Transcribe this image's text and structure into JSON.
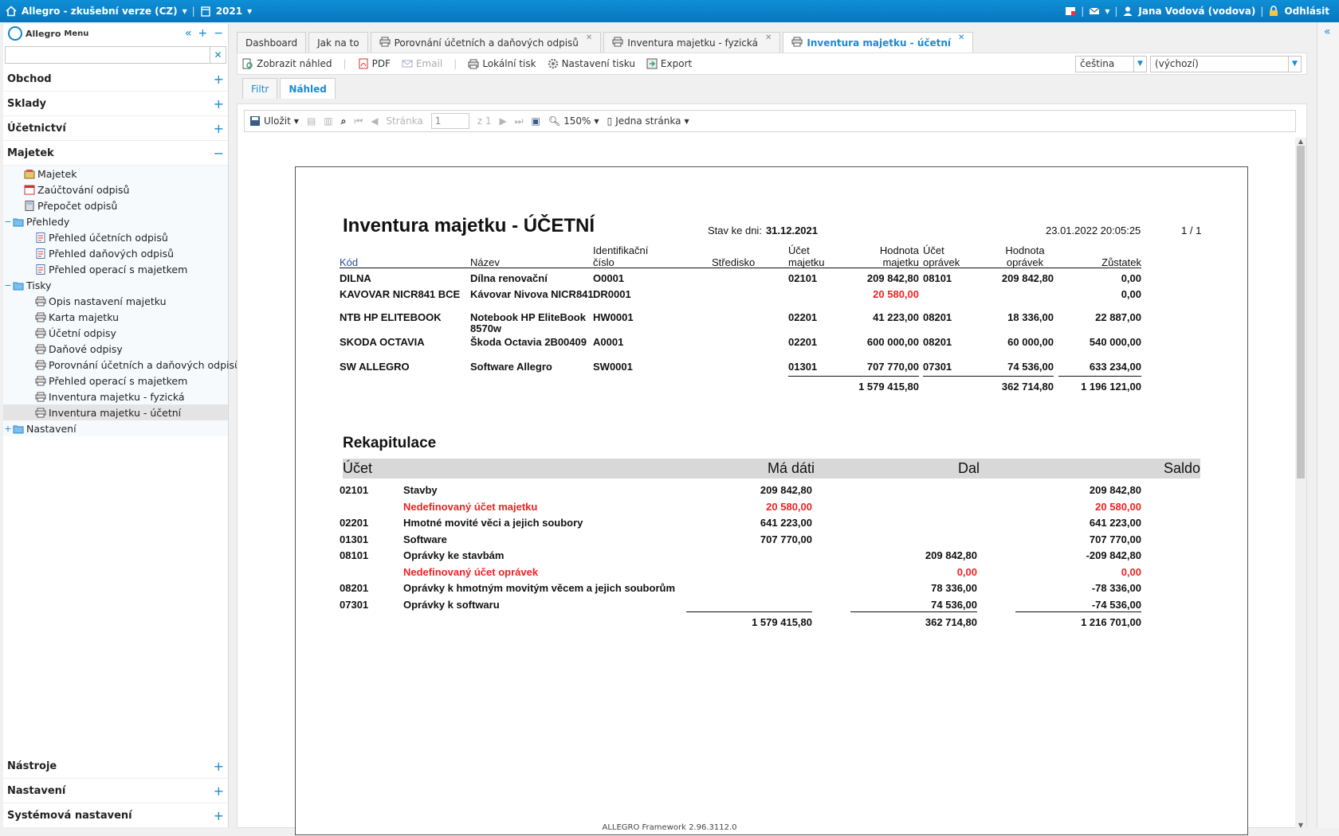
{
  "topbar": {
    "app_title": "Allegro - zkušební verze (CZ)",
    "year": "2021",
    "user": "Jana Vodová (vodova)",
    "logout": "Odhlásit"
  },
  "sidebar": {
    "app_name": "Allegro",
    "menu_label": "Menu",
    "search_placeholder": "",
    "sections_top": [
      {
        "label": "Obchod",
        "toggle": "+"
      },
      {
        "label": "Sklady",
        "toggle": "+"
      },
      {
        "label": "Účetnictví",
        "toggle": "+"
      },
      {
        "label": "Majetek",
        "toggle": "−"
      }
    ],
    "tree": [
      {
        "label": "Majetek",
        "indent": 1,
        "icon": "asset-icon"
      },
      {
        "label": "Zaúčtování odpisů",
        "indent": 1,
        "icon": "calendar-icon"
      },
      {
        "label": "Přepočet odpisů",
        "indent": 1,
        "icon": "calculator-icon"
      },
      {
        "label": "Přehledy",
        "indent": 0,
        "icon": "folder-icon",
        "exp": "−"
      },
      {
        "label": "Přehled účetních odpisů",
        "indent": 2,
        "icon": "report-icon"
      },
      {
        "label": "Přehled daňových odpisů",
        "indent": 2,
        "icon": "report-icon"
      },
      {
        "label": "Přehled operací s majetkem",
        "indent": 2,
        "icon": "report-icon"
      },
      {
        "label": "Tisky",
        "indent": 0,
        "icon": "folder-icon",
        "exp": "−"
      },
      {
        "label": "Opis nastavení majetku",
        "indent": 2,
        "icon": "printer-icon"
      },
      {
        "label": "Karta majetku",
        "indent": 2,
        "icon": "printer-icon"
      },
      {
        "label": "Účetní odpisy",
        "indent": 2,
        "icon": "printer-icon"
      },
      {
        "label": "Daňové odpisy",
        "indent": 2,
        "icon": "printer-icon"
      },
      {
        "label": "Porovnání účetních a daňových odpisů",
        "indent": 2,
        "icon": "printer-icon"
      },
      {
        "label": "Přehled operací s majetkem",
        "indent": 2,
        "icon": "printer-icon"
      },
      {
        "label": "Inventura majetku - fyzická",
        "indent": 2,
        "icon": "printer-icon"
      },
      {
        "label": "Inventura majetku - účetní",
        "indent": 2,
        "icon": "printer-icon",
        "selected": true
      },
      {
        "label": "Nastavení",
        "indent": 0,
        "icon": "folder-icon",
        "exp": "+"
      }
    ],
    "sections_bottom": [
      {
        "label": "Nástroje",
        "toggle": "+"
      },
      {
        "label": "Nastavení",
        "toggle": "+"
      },
      {
        "label": "Systémová nastavení",
        "toggle": "+"
      }
    ]
  },
  "tabs": [
    {
      "label": "Dashboard"
    },
    {
      "label": "Jak na to"
    },
    {
      "label": "Porovnání účetních a daňových odpisů",
      "closable": true,
      "icon": true
    },
    {
      "label": "Inventura majetku - fyzická",
      "closable": true,
      "icon": true
    },
    {
      "label": "Inventura majetku - účetní",
      "closable": true,
      "icon": true,
      "active": true
    }
  ],
  "toolbar": {
    "preview": "Zobrazit náhled",
    "pdf": "PDF",
    "email": "Email",
    "local_print": "Lokální tisk",
    "print_settings": "Nastavení tisku",
    "export": "Export",
    "language": "čeština",
    "variant": "(výchozí)"
  },
  "subtabs": {
    "filter": "Filtr",
    "preview": "Náhled"
  },
  "viewer": {
    "save": "Uložit",
    "page_label": "Stránka",
    "page_value": "1",
    "of_label": "z 1",
    "zoom": "150%",
    "layout": "Jedna stránka"
  },
  "report": {
    "title": "Inventura majetku - ÚČETNÍ",
    "stav_label": "Stav ke dni:",
    "stav_value": "31.12.2021",
    "datetime": "23.01.2022 20:05:25",
    "page": "1 / 1",
    "headers": {
      "kod": "Kód",
      "nazev": "Název",
      "ident1": "Identifikační",
      "ident2": "číslo",
      "stredisko": "Středisko",
      "ucet1": "Účet",
      "ucet2": "majetku",
      "hodnota1": "Hodnota",
      "hodnota2": "majetku",
      "ucetopr1": "Účet",
      "ucetopr2": "oprávek",
      "hodnotaopr1": "Hodnota",
      "hodnotaopr2": "oprávek",
      "zustatek": "Zůstatek"
    },
    "rows": [
      {
        "kod": "DILNA",
        "nazev": "Dílna renovační",
        "nazev2": "",
        "ident": "O0001",
        "ucet": "02101",
        "hodnota": "209 842,80",
        "hodnota_red": false,
        "ucetopr": "08101",
        "opravky": "209 842,80",
        "zustatek": "0,00"
      },
      {
        "kod": "KAVOVAR NICR841 BCE",
        "nazev": "Kávovar Nivova NICR841",
        "nazev2": "",
        "ident": "DR0001",
        "ucet": "",
        "hodnota": "20 580,00",
        "hodnota_red": true,
        "ucetopr": "",
        "opravky": "",
        "zustatek": "0,00"
      },
      {
        "kod": "NTB HP ELITEBOOK",
        "nazev": "Notebook HP EliteBook",
        "nazev2": "8570w",
        "ident": "HW0001",
        "ucet": "02201",
        "hodnota": "41 223,00",
        "hodnota_red": false,
        "ucetopr": "08201",
        "opravky": "18 336,00",
        "zustatek": "22 887,00"
      },
      {
        "kod": "SKODA OCTAVIA",
        "nazev": "Škoda Octavia 2B00409",
        "nazev2": "",
        "ident": "A0001",
        "ucet": "02201",
        "hodnota": "600 000,00",
        "hodnota_red": false,
        "ucetopr": "08201",
        "opravky": "60 000,00",
        "zustatek": "540 000,00"
      },
      {
        "kod": "SW ALLEGRO",
        "nazev": "Software Allegro",
        "nazev2": "",
        "ident": "SW0001",
        "ucet": "01301",
        "hodnota": "707 770,00",
        "hodnota_red": false,
        "ucetopr": "07301",
        "opravky": "74 536,00",
        "zustatek": "633 234,00"
      }
    ],
    "totals": {
      "hodnota": "1 579 415,80",
      "opravky": "362 714,80",
      "zustatek": "1 196 121,00"
    },
    "rekap": {
      "title": "Rekapitulace",
      "h_ucet": "Účet",
      "h_madati": "Má dáti",
      "h_dal": "Dal",
      "h_saldo": "Saldo",
      "rows": [
        {
          "ucet": "02101",
          "nazev": "Stavby",
          "madati": "209 842,80",
          "dal": "",
          "saldo": "209 842,80",
          "red": false
        },
        {
          "ucet": "",
          "nazev": "Nedefinovaný účet majetku",
          "madati": "20 580,00",
          "dal": "",
          "saldo": "20 580,00",
          "red": true
        },
        {
          "ucet": "02201",
          "nazev": "Hmotné movité věci a jejich soubory",
          "madati": "641 223,00",
          "dal": "",
          "saldo": "641 223,00",
          "red": false
        },
        {
          "ucet": "01301",
          "nazev": "Software",
          "madati": "707 770,00",
          "dal": "",
          "saldo": "707 770,00",
          "red": false
        },
        {
          "ucet": "08101",
          "nazev": "Oprávky ke stavbám",
          "madati": "",
          "dal": "209 842,80",
          "saldo": "-209 842,80",
          "red": false
        },
        {
          "ucet": "",
          "nazev": "Nedefinovaný účet oprávek",
          "madati": "",
          "dal": "0,00",
          "saldo": "0,00",
          "red": true
        },
        {
          "ucet": "08201",
          "nazev": "Oprávky k hmotným movitým věcem a jejich souborům",
          "madati": "",
          "dal": "78 336,00",
          "saldo": "-78 336,00",
          "red": false
        },
        {
          "ucet": "07301",
          "nazev": "Oprávky k softwaru",
          "madati": "",
          "dal": "74 536,00",
          "saldo": "-74 536,00",
          "red": false
        }
      ],
      "totals": {
        "madati": "1 579 415,80",
        "dal": "362 714,80",
        "saldo": "1 216 701,00"
      }
    }
  },
  "footer": "ALLEGRO Framework 2.96.3112.0",
  "colors": {
    "accent": "#1a8ad4",
    "topbar": "#0876bd",
    "negative": "#e22222"
  }
}
